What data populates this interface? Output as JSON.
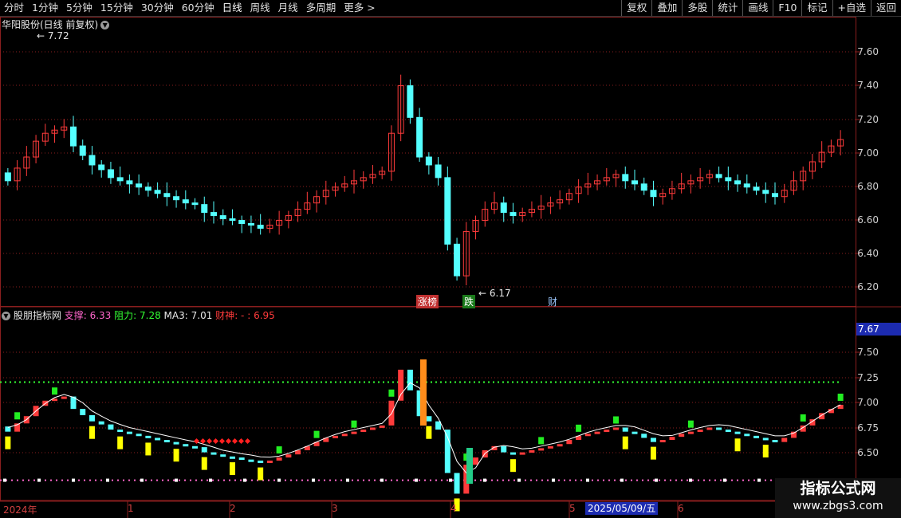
{
  "toolbar": {
    "periods": [
      "分时",
      "1分钟",
      "5分钟",
      "15分钟",
      "30分钟",
      "60分钟",
      "日线",
      "周线",
      "月线",
      "多周期",
      "更多 >"
    ],
    "actions": [
      "复权",
      "叠加",
      "多股",
      "统计",
      "画线",
      "F10",
      "标记",
      "+自选",
      "返回"
    ]
  },
  "main_chart": {
    "title": "华阳股份(日线 前复权)",
    "high_label": "7.72",
    "low_label": "6.17",
    "event_tags": [
      "涨榜",
      "跌",
      "财"
    ],
    "y_ticks": [
      "7.60",
      "7.40",
      "7.20",
      "7.00",
      "6.80",
      "6.60",
      "6.40",
      "6.20"
    ]
  },
  "indicator": {
    "name": "股朋指标网",
    "support_label": "支撑",
    "support_value": "6.33",
    "resist_label": "阻力",
    "resist_value": "7.28",
    "ma_label": "MA3",
    "ma_value": "7.01",
    "wealth_label": "财神",
    "wealth_value": "6.95",
    "y_ticks": [
      "7.50",
      "7.25",
      "7.00",
      "6.75",
      "6.50"
    ],
    "cursor_value": "7.67"
  },
  "time_axis": {
    "labels": [
      "2024年",
      "1",
      "2",
      "3",
      "4",
      "5",
      "6"
    ],
    "cursor_date": "2025/05/09/五"
  },
  "watermark": {
    "title": "指标公式网",
    "url": "www.zbgs3.com"
  },
  "colors": {
    "up": "#ff3b3b",
    "down": "#54ffff",
    "grid": "#8a1e1e",
    "support": "#ff66cc",
    "resist": "#33ff33",
    "signal": "#ffff00"
  },
  "chart_data": {
    "type": "candlestick",
    "series_main": {
      "close": [
        6.8,
        6.88,
        6.95,
        7.05,
        7.1,
        7.12,
        7.14,
        7.02,
        6.96,
        6.9,
        6.87,
        6.82,
        6.8,
        6.78,
        6.76,
        6.74,
        6.72,
        6.7,
        6.68,
        6.66,
        6.65,
        6.6,
        6.58,
        6.56,
        6.55,
        6.53,
        6.52,
        6.5,
        6.52,
        6.55,
        6.58,
        6.62,
        6.66,
        6.7,
        6.74,
        6.76,
        6.78,
        6.8,
        6.82,
        6.84,
        6.86,
        7.1,
        7.4,
        7.2,
        6.95,
        6.9,
        6.82,
        6.4,
        6.2,
        6.48,
        6.55,
        6.62,
        6.66,
        6.6,
        6.58,
        6.6,
        6.62,
        6.64,
        6.66,
        6.68,
        6.72,
        6.76,
        6.78,
        6.8,
        6.82,
        6.84,
        6.8,
        6.78,
        6.74,
        6.7,
        6.72,
        6.75,
        6.78,
        6.8,
        6.82,
        6.84,
        6.82,
        6.8,
        6.78,
        6.76,
        6.74,
        6.72,
        6.7,
        6.74,
        6.8,
        6.86,
        6.92,
        6.98,
        7.02,
        7.06
      ]
    },
    "y_range_main": [
      6.12,
      7.74
    ],
    "y_range_indicator": [
      6.35,
      7.7
    ]
  }
}
